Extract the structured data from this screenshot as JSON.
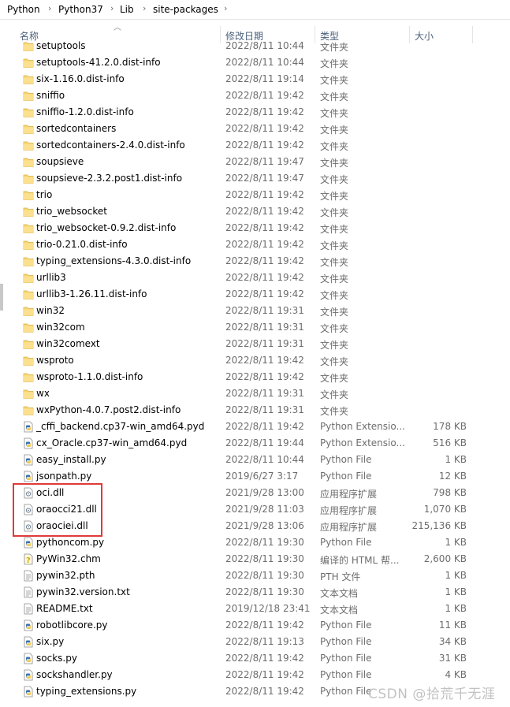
{
  "breadcrumb": [
    "Python",
    "Python37",
    "Lib",
    "site-packages"
  ],
  "columns": {
    "name": "名称",
    "date": "修改日期",
    "type": "类型",
    "size": "大小"
  },
  "colors": {
    "folder": "#f8d775",
    "highlight": "#e03a3a",
    "header_text": "#4c607a",
    "secondary_text": "#6d6d6d"
  },
  "files": [
    {
      "name": "setuptools",
      "date": "2022/8/11 10:44",
      "type": "文件夹",
      "size": "",
      "icon": "folder-icon"
    },
    {
      "name": "setuptools-41.2.0.dist-info",
      "date": "2022/8/11 10:44",
      "type": "文件夹",
      "size": "",
      "icon": "folder-icon"
    },
    {
      "name": "six-1.16.0.dist-info",
      "date": "2022/8/11 19:14",
      "type": "文件夹",
      "size": "",
      "icon": "folder-icon"
    },
    {
      "name": "sniffio",
      "date": "2022/8/11 19:42",
      "type": "文件夹",
      "size": "",
      "icon": "folder-icon"
    },
    {
      "name": "sniffio-1.2.0.dist-info",
      "date": "2022/8/11 19:42",
      "type": "文件夹",
      "size": "",
      "icon": "folder-icon"
    },
    {
      "name": "sortedcontainers",
      "date": "2022/8/11 19:42",
      "type": "文件夹",
      "size": "",
      "icon": "folder-icon"
    },
    {
      "name": "sortedcontainers-2.4.0.dist-info",
      "date": "2022/8/11 19:42",
      "type": "文件夹",
      "size": "",
      "icon": "folder-icon"
    },
    {
      "name": "soupsieve",
      "date": "2022/8/11 19:47",
      "type": "文件夹",
      "size": "",
      "icon": "folder-icon"
    },
    {
      "name": "soupsieve-2.3.2.post1.dist-info",
      "date": "2022/8/11 19:47",
      "type": "文件夹",
      "size": "",
      "icon": "folder-icon"
    },
    {
      "name": "trio",
      "date": "2022/8/11 19:42",
      "type": "文件夹",
      "size": "",
      "icon": "folder-icon"
    },
    {
      "name": "trio_websocket",
      "date": "2022/8/11 19:42",
      "type": "文件夹",
      "size": "",
      "icon": "folder-icon"
    },
    {
      "name": "trio_websocket-0.9.2.dist-info",
      "date": "2022/8/11 19:42",
      "type": "文件夹",
      "size": "",
      "icon": "folder-icon"
    },
    {
      "name": "trio-0.21.0.dist-info",
      "date": "2022/8/11 19:42",
      "type": "文件夹",
      "size": "",
      "icon": "folder-icon"
    },
    {
      "name": "typing_extensions-4.3.0.dist-info",
      "date": "2022/8/11 19:42",
      "type": "文件夹",
      "size": "",
      "icon": "folder-icon"
    },
    {
      "name": "urllib3",
      "date": "2022/8/11 19:42",
      "type": "文件夹",
      "size": "",
      "icon": "folder-icon"
    },
    {
      "name": "urllib3-1.26.11.dist-info",
      "date": "2022/8/11 19:42",
      "type": "文件夹",
      "size": "",
      "icon": "folder-icon"
    },
    {
      "name": "win32",
      "date": "2022/8/11 19:31",
      "type": "文件夹",
      "size": "",
      "icon": "folder-icon"
    },
    {
      "name": "win32com",
      "date": "2022/8/11 19:31",
      "type": "文件夹",
      "size": "",
      "icon": "folder-icon"
    },
    {
      "name": "win32comext",
      "date": "2022/8/11 19:31",
      "type": "文件夹",
      "size": "",
      "icon": "folder-icon"
    },
    {
      "name": "wsproto",
      "date": "2022/8/11 19:42",
      "type": "文件夹",
      "size": "",
      "icon": "folder-icon"
    },
    {
      "name": "wsproto-1.1.0.dist-info",
      "date": "2022/8/11 19:42",
      "type": "文件夹",
      "size": "",
      "icon": "folder-icon"
    },
    {
      "name": "wx",
      "date": "2022/8/11 19:31",
      "type": "文件夹",
      "size": "",
      "icon": "folder-icon"
    },
    {
      "name": "wxPython-4.0.7.post2.dist-info",
      "date": "2022/8/11 19:31",
      "type": "文件夹",
      "size": "",
      "icon": "folder-icon"
    },
    {
      "name": "_cffi_backend.cp37-win_amd64.pyd",
      "date": "2022/8/11 19:42",
      "type": "Python Extensio...",
      "size": "178 KB",
      "icon": "python-file-icon"
    },
    {
      "name": "cx_Oracle.cp37-win_amd64.pyd",
      "date": "2022/8/11 19:44",
      "type": "Python Extensio...",
      "size": "516 KB",
      "icon": "python-file-icon"
    },
    {
      "name": "easy_install.py",
      "date": "2022/8/11 10:44",
      "type": "Python File",
      "size": "1 KB",
      "icon": "python-file-icon"
    },
    {
      "name": "jsonpath.py",
      "date": "2019/6/27 3:17",
      "type": "Python File",
      "size": "12 KB",
      "icon": "python-file-icon"
    },
    {
      "name": "oci.dll",
      "date": "2021/9/28 13:00",
      "type": "应用程序扩展",
      "size": "798 KB",
      "icon": "dll-file-icon"
    },
    {
      "name": "oraocci21.dll",
      "date": "2021/9/28 11:03",
      "type": "应用程序扩展",
      "size": "1,070 KB",
      "icon": "dll-file-icon"
    },
    {
      "name": "oraociei.dll",
      "date": "2021/9/28 13:06",
      "type": "应用程序扩展",
      "size": "215,136 KB",
      "icon": "dll-file-icon"
    },
    {
      "name": "pythoncom.py",
      "date": "2022/8/11 19:30",
      "type": "Python File",
      "size": "1 KB",
      "icon": "python-file-icon"
    },
    {
      "name": "PyWin32.chm",
      "date": "2022/8/11 19:30",
      "type": "编译的 HTML 帮...",
      "size": "2,600 KB",
      "icon": "help-file-icon"
    },
    {
      "name": "pywin32.pth",
      "date": "2022/8/11 19:30",
      "type": "PTH 文件",
      "size": "1 KB",
      "icon": "text-file-icon"
    },
    {
      "name": "pywin32.version.txt",
      "date": "2022/8/11 19:30",
      "type": "文本文档",
      "size": "1 KB",
      "icon": "text-file-icon"
    },
    {
      "name": "README.txt",
      "date": "2019/12/18 23:41",
      "type": "文本文档",
      "size": "1 KB",
      "icon": "text-file-icon"
    },
    {
      "name": "robotlibcore.py",
      "date": "2022/8/11 19:42",
      "type": "Python File",
      "size": "11 KB",
      "icon": "python-file-icon"
    },
    {
      "name": "six.py",
      "date": "2022/8/11 19:13",
      "type": "Python File",
      "size": "34 KB",
      "icon": "python-file-icon"
    },
    {
      "name": "socks.py",
      "date": "2022/8/11 19:42",
      "type": "Python File",
      "size": "31 KB",
      "icon": "python-file-icon"
    },
    {
      "name": "sockshandler.py",
      "date": "2022/8/11 19:42",
      "type": "Python File",
      "size": "4 KB",
      "icon": "python-file-icon"
    },
    {
      "name": "typing_extensions.py",
      "date": "2022/8/11 19:42",
      "type": "Python File",
      "size": "",
      "icon": "python-file-icon"
    }
  ],
  "watermark": "CSDN @拾荒千无涯"
}
